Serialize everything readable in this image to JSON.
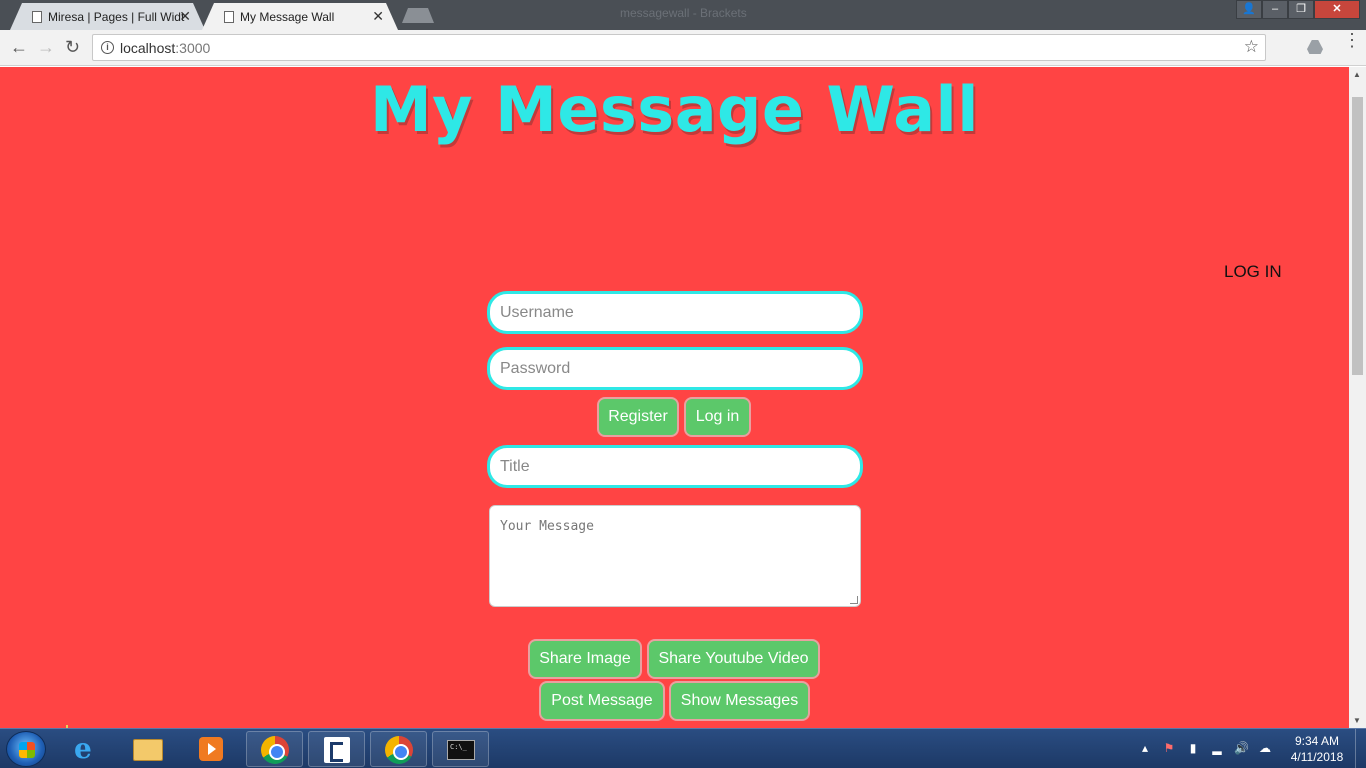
{
  "browser": {
    "tabs": [
      {
        "label": "Miresa | Pages | Full Widt",
        "close": "✕"
      },
      {
        "label": "My Message Wall",
        "close": "✕"
      }
    ],
    "window_title": "messagewall - Brackets",
    "url_host": "localhost",
    "url_port": ":3000",
    "back": "←",
    "forward": "→",
    "reload": "↻",
    "info": "i",
    "star": "☆",
    "menu": "⋮",
    "win_min": "–",
    "win_restore": "❐",
    "win_close": "✕",
    "win_user": "👤"
  },
  "page": {
    "background": "#ff4444",
    "accent": "#2ee8e6",
    "button_color": "#5cc86a",
    "title": "My Message Wall",
    "login_link": "LOG IN",
    "username_placeholder": "Username",
    "password_placeholder": "Password",
    "register_label": "Register",
    "login_label": "Log in",
    "title_placeholder": "Title",
    "message_placeholder": "Your Message",
    "share_image_label": "Share Image",
    "share_video_label": "Share Youtube Video",
    "post_label": "Post Message",
    "show_label": "Show Messages"
  },
  "taskbar": {
    "cmd_text": "C:\\_",
    "time": "9:34 AM",
    "date": "4/11/2018",
    "tray_icons": [
      "show-hidden-icon",
      "flag-icon",
      "battery-icon",
      "signal-icon",
      "volume-icon",
      "cloud-icon"
    ],
    "tray_glyphs": [
      "▴",
      "⚑",
      "▮",
      "▂",
      "🔊",
      "☁"
    ]
  }
}
